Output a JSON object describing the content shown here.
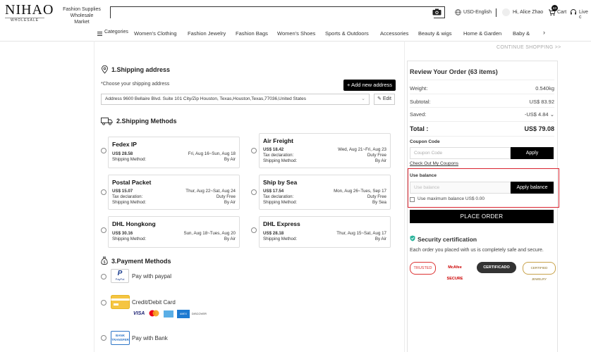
{
  "header": {
    "logo_main": "NIHAO",
    "logo_sub": "WHOLESALE",
    "tagline_line1": "Fashion Supplies",
    "tagline_line2": "Wholesale Market",
    "search_placeholder": "",
    "currency": "USD-English",
    "greeting": "Hi, Alice Zhao",
    "cart_label": "Cart",
    "cart_count": "63",
    "live_chat": "Live c"
  },
  "nav": {
    "categories": "Categories",
    "items": [
      "Women's Clothing",
      "Fashion Jewelry",
      "Fashion Bags",
      "Women's Shoes",
      "Sports & Outdoors",
      "Accessories",
      "Beauty & wigs",
      "Home & Garden",
      "Baby &"
    ]
  },
  "continue_shopping": "CONTINUE SHOPPING >>",
  "shipping_address": {
    "title": "1.Shipping address",
    "prompt": "*Choose your shipping address",
    "add_button": "+ Add new address",
    "selected": "Address 9600 Bellaire Blvd. Suite 101 City/Zip Houston, Texas,Houston,Texas,77036,United States",
    "edit_button": "Edit"
  },
  "shipping_methods": {
    "title": "2.Shipping Methods",
    "options": [
      {
        "name": "Fedex IP",
        "price": "US$ 28.58",
        "dates": "Fri, Aug 16~Sun, Aug 18",
        "method_label": "Shipping Method:",
        "method": "By Air",
        "tax_label": "",
        "tax": ""
      },
      {
        "name": "Air Freight",
        "price": "US$ 18.42",
        "dates": "Wed, Aug 21~Fri, Aug 23",
        "tax_label": "Tax declaration:",
        "tax": "Duty Free",
        "method_label": "Shipping Method:",
        "method": "By Air"
      },
      {
        "name": "Postal Packet",
        "price": "US$ 15.07",
        "dates": "Thur, Aug 22~Sat, Aug 24",
        "tax_label": "Tax declaration:",
        "tax": "Duty Free",
        "method_label": "Shipping Method:",
        "method": "By Air"
      },
      {
        "name": "Ship by Sea",
        "price": "US$ 17.54",
        "dates": "Mon, Aug 26~Tues, Sep 17",
        "tax_label": "Tax declaration:",
        "tax": "Duty Free",
        "method_label": "Shipping Method:",
        "method": "By Sea"
      },
      {
        "name": "DHL Hongkong",
        "price": "US$ 30.16",
        "dates": "Sun, Aug 18~Tues, Aug 20",
        "method_label": "Shipping Method:",
        "method": "By Air",
        "tax_label": "",
        "tax": ""
      },
      {
        "name": "DHL Express",
        "price": "US$ 28.18",
        "dates": "Thur, Aug 15~Sat, Aug 17",
        "method_label": "Shipping Method:",
        "method": "By Air",
        "tax_label": "",
        "tax": ""
      }
    ]
  },
  "payment_methods": {
    "title": "3.Payment Methods",
    "paypal": "Pay with paypal",
    "paypal_logo": "PayPal",
    "card": "Credit/Debit Card",
    "bank": "Pay with Bank",
    "bank_logo": "BANK TRANSFER",
    "card_logos": [
      "VISA",
      "",
      "AMEX",
      "DISCOVER"
    ]
  },
  "review": {
    "title": "Review Your Order (63 items)",
    "weight_label": "Weight:",
    "weight": "0.540kg",
    "subtotal_label": "Subtotal:",
    "subtotal": "US$ 83.92",
    "saved_label": "Saved:",
    "saved": "-US$ 4.84",
    "total_label": "Total :",
    "total": "US$ 79.08",
    "coupon_title": "Coupon Code",
    "coupon_placeholder": "Coupon Code",
    "apply": "Apply",
    "check_coupons": "Check Out My Coupons",
    "balance_title": "Use balance",
    "balance_placeholder": "Use balance",
    "apply_balance": "Apply balance",
    "use_max": "Use maximum balance US$ 0.00",
    "place_order": "PLACE ORDER"
  },
  "security": {
    "title": "Security certification",
    "text": "Each order you placed with us is completely safe and secure.",
    "badges": [
      "TRUSTED",
      "McAfee SECURE",
      "CERTIFICADO",
      "CERTIFIED JEWELRY"
    ]
  },
  "colors": {
    "accent": "#000000",
    "alert_border": "#d9232f",
    "gold": "#c8a24a"
  }
}
